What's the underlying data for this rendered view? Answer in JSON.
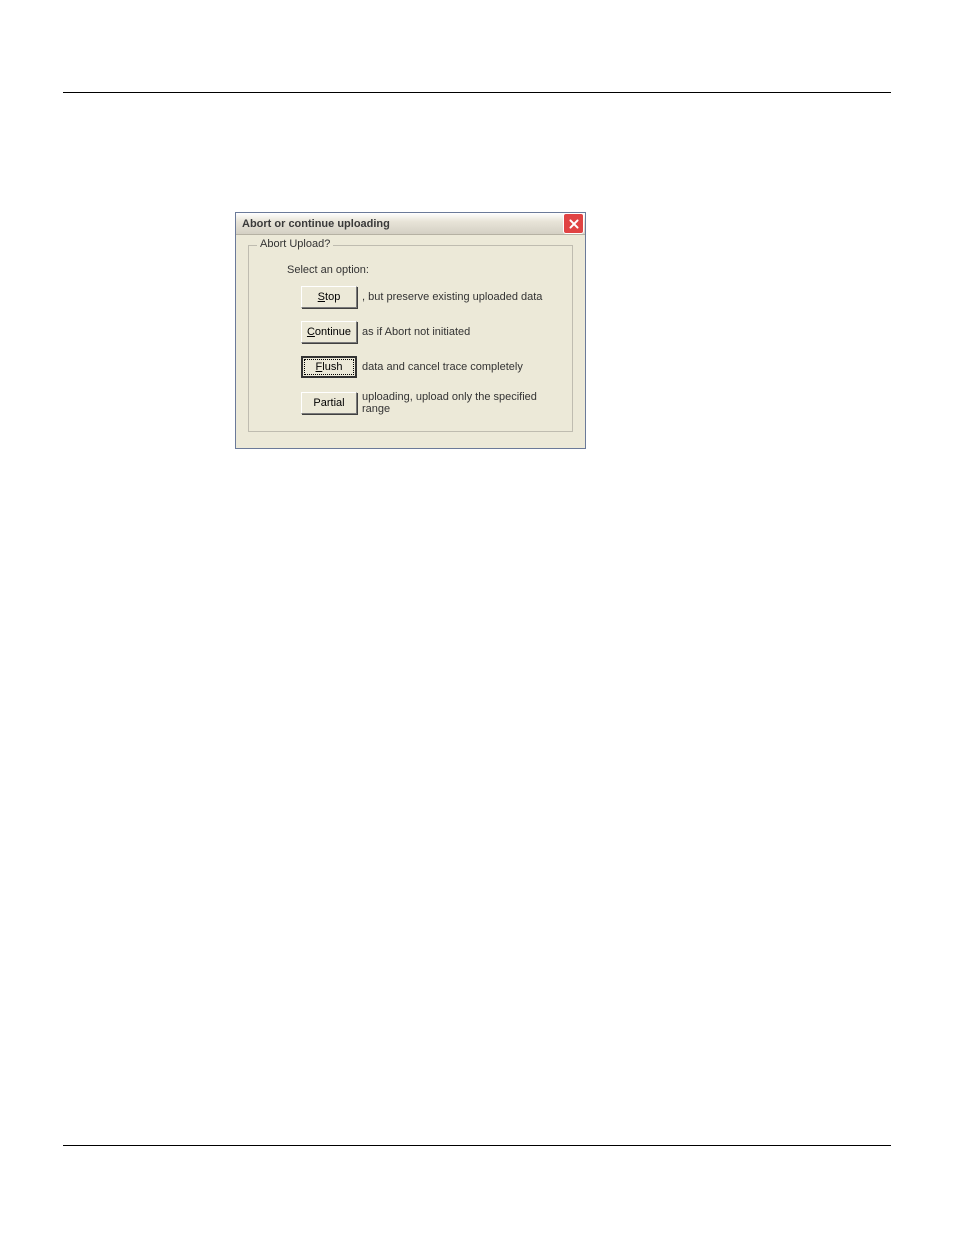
{
  "dialog": {
    "title": "Abort or continue uploading",
    "groupbox_legend": "Abort Upload?",
    "prompt": "Select an option:",
    "options": [
      {
        "button_mnemonic": "S",
        "button_rest": "top",
        "desc": ", but preserve existing uploaded data"
      },
      {
        "button_mnemonic": "C",
        "button_rest": "ontinue",
        "desc": "as if Abort not initiated"
      },
      {
        "button_mnemonic": "F",
        "button_rest": "lush",
        "desc": "data and cancel trace completely",
        "focused": true
      },
      {
        "button_mnemonic": "",
        "button_rest": "Partial",
        "desc": "uploading, upload only the specified range"
      }
    ]
  }
}
